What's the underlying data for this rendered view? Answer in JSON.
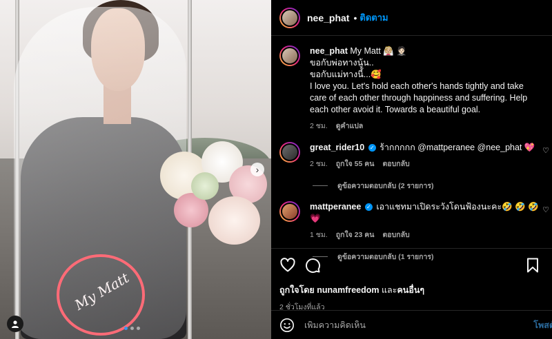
{
  "post": {
    "username": "nee_phat",
    "follow_label": "ติดตาม",
    "separator": "•",
    "next_arrow": "›",
    "watermark_text": "My Matt"
  },
  "caption": {
    "username": "nee_phat",
    "line1_text": "My Matt 👰🏼 🤵🏻",
    "line2": "ขอกับพ่อทางนู้น..",
    "line3": "ขอกับแม่ทางนี้...🥰",
    "line4": "I love you. Let's hold each other's hands tightly and take care of each other through happiness and suffering. Help each other avoid it. Towards a beautiful goal.",
    "time": "2 ชม.",
    "translate": "ดูคำแปล"
  },
  "comments": [
    {
      "username": "great_rider10",
      "verified_mark": "✓",
      "text": "ร้ากกกกก @mattperanee @nee_phat 💖",
      "time": "2 ชม.",
      "likes": "ถูกใจ 55 คน",
      "reply": "ตอบกลับ",
      "view_replies": "ดูข้อความตอบกลับ (2 รายการ)"
    },
    {
      "username": "mattperanee",
      "verified_mark": "✓",
      "text": "เอาแชทมาเปิดระวังโดนฟ้องนะคะ🤣 🤣 🤣 💗",
      "time": "1 ชม.",
      "likes": "ถูกใจ 23 คน",
      "reply": "ตอบกลับ",
      "view_replies": "ดูข้อความตอบกลับ (1 รายการ)"
    }
  ],
  "liked_by": {
    "prefix": "ถูกใจโดย",
    "user": "nunamfreedom",
    "and": "และ",
    "others": "คนอื่นๆ"
  },
  "post_time": "2 ชั่วโมงที่แล้ว",
  "add_comment": {
    "placeholder": "เพิ่มความคิดเห็น",
    "post_label": "โพสต์"
  },
  "colors": {
    "accent": "#0095f6",
    "circle_mark": "#ff6b77",
    "background": "#000000"
  }
}
